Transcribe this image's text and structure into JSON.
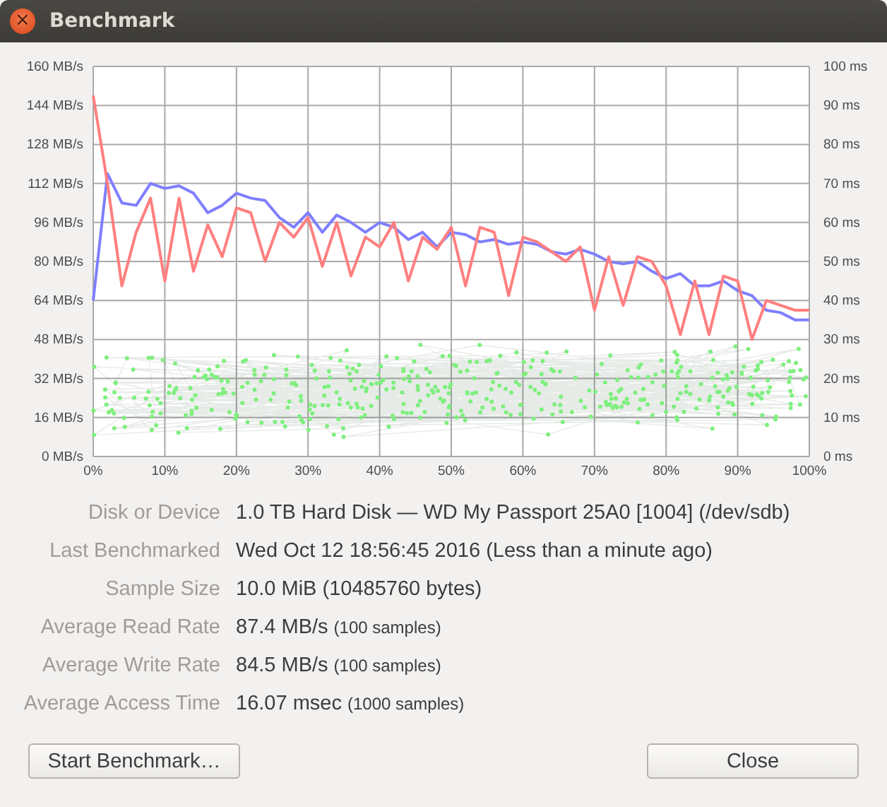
{
  "window": {
    "title": "Benchmark",
    "close_icon": "×"
  },
  "chart": {
    "chart_data": {
      "type": "line",
      "x": [
        0,
        2,
        4,
        6,
        8,
        10,
        12,
        14,
        16,
        18,
        20,
        22,
        24,
        26,
        28,
        30,
        32,
        34,
        36,
        38,
        40,
        42,
        44,
        46,
        48,
        50,
        52,
        54,
        56,
        58,
        60,
        62,
        64,
        66,
        68,
        70,
        72,
        74,
        76,
        78,
        80,
        82,
        84,
        86,
        88,
        90,
        92,
        94,
        96,
        98,
        100
      ],
      "series": [
        {
          "color": "#7f7fff",
          "values": [
            64,
            116,
            104,
            103,
            112,
            110,
            111,
            108,
            100,
            103,
            108,
            106,
            105,
            98,
            94,
            100,
            92,
            99,
            96,
            92,
            96,
            94,
            89,
            92,
            86,
            92,
            91,
            88,
            89,
            87,
            88,
            87,
            84,
            83,
            85,
            83,
            80,
            79,
            80,
            76,
            73,
            75,
            70,
            70,
            72,
            68,
            66,
            60,
            59,
            56,
            56
          ]
        },
        {
          "color": "#ff7f7f",
          "values": [
            148,
            112,
            70,
            92,
            106,
            72,
            106,
            76,
            95,
            82,
            102,
            100,
            80,
            96,
            90,
            98,
            78,
            96,
            74,
            90,
            86,
            96,
            72,
            90,
            85,
            94,
            70,
            94,
            92,
            66,
            90,
            88,
            84,
            80,
            86,
            60,
            82,
            62,
            82,
            80,
            70,
            50,
            72,
            50,
            74,
            72,
            48,
            64,
            62,
            60,
            60
          ]
        }
      ],
      "xlim": [
        0,
        100
      ],
      "ylim": [
        0,
        160
      ],
      "xticks": [
        {
          "value": 0,
          "label": "0%"
        },
        {
          "value": 10,
          "label": "10%"
        },
        {
          "value": 20,
          "label": "20%"
        },
        {
          "value": 30,
          "label": "30%"
        },
        {
          "value": 40,
          "label": "40%"
        },
        {
          "value": 50,
          "label": "50%"
        },
        {
          "value": 60,
          "label": "60%"
        },
        {
          "value": 70,
          "label": "70%"
        },
        {
          "value": 80,
          "label": "80%"
        },
        {
          "value": 90,
          "label": "90%"
        },
        {
          "value": 100,
          "label": "100%"
        }
      ],
      "yticks": [
        {
          "value": 0,
          "label": "0 MB/s"
        },
        {
          "value": 16,
          "label": "16 MB/s"
        },
        {
          "value": 32,
          "label": "32 MB/s"
        },
        {
          "value": 48,
          "label": "48 MB/s"
        },
        {
          "value": 64,
          "label": "64 MB/s"
        },
        {
          "value": 80,
          "label": "80 MB/s"
        },
        {
          "value": 96,
          "label": "96 MB/s"
        },
        {
          "value": 112,
          "label": "112 MB/s"
        },
        {
          "value": 128,
          "label": "128 MB/s"
        },
        {
          "value": 144,
          "label": "144 MB/s"
        },
        {
          "value": 160,
          "label": "160 MB/s"
        }
      ],
      "y2ticks": [
        {
          "value": 0,
          "label": "0 ms"
        },
        {
          "value": 10,
          "label": "10 ms"
        },
        {
          "value": 20,
          "label": "20 ms"
        },
        {
          "value": 30,
          "label": "30 ms"
        },
        {
          "value": 40,
          "label": "40 ms"
        },
        {
          "value": 50,
          "label": "50 ms"
        },
        {
          "value": 60,
          "label": "60 ms"
        },
        {
          "value": 70,
          "label": "70 ms"
        },
        {
          "value": 80,
          "label": "80 ms"
        },
        {
          "value": 90,
          "label": "90 ms"
        },
        {
          "value": 100,
          "label": "100 ms"
        }
      ],
      "y2lim": [
        0,
        100
      ],
      "grid": true
    }
  },
  "info": [
    {
      "label": "Disk or Device",
      "value": "1.0 TB Hard Disk — WD My Passport 25A0 [1004] (/dev/sdb)"
    },
    {
      "label": "Last Benchmarked",
      "value": "Wed Oct 12 18:56:45 2016 (Less than a minute ago)"
    },
    {
      "label": "Sample Size",
      "value": "10.0 MiB (10485760 bytes)"
    },
    {
      "label": "Average Read Rate",
      "value": "87.4 MB/s",
      "note": "(100 samples)"
    },
    {
      "label": "Average Write Rate",
      "value": "84.5 MB/s",
      "note": "(100 samples)"
    },
    {
      "label": "Average Access Time",
      "value": "16.07 msec",
      "note": "(1000 samples)"
    }
  ],
  "buttons": {
    "start": "Start Benchmark…",
    "close": "Close"
  }
}
